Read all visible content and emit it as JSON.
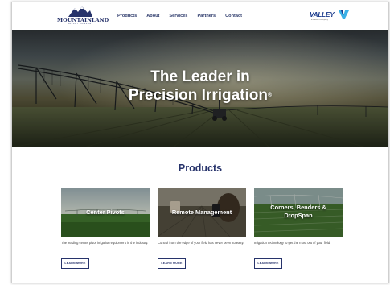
{
  "header": {
    "logo": {
      "name": "MOUNTAINLAND",
      "tagline": "SUPPLY COMPANY"
    },
    "nav": [
      "Products",
      "About",
      "Services",
      "Partners",
      "Contact"
    ],
    "partner_logo": {
      "name": "VALLEY",
      "tagline": "a Valmont company"
    }
  },
  "hero": {
    "line1": "The Leader in",
    "line2": "Precision Irrigation",
    "mark": "®"
  },
  "products": {
    "title": "Products",
    "cards": [
      {
        "title": "Center Pivots",
        "description": "The leading center pivot irrigation equipment in the industry.",
        "button": "LEARN MORE"
      },
      {
        "title": "Remote Management",
        "description": "Control from the edge of your field has never been so easy.",
        "button": "LEARN MORE"
      },
      {
        "title_line1": "Corners, Benders &",
        "title_line2": "DropSpan",
        "description": "Irrigation technology to get the most out of your field.",
        "button": "LEARN MORE"
      }
    ]
  },
  "colors": {
    "brand_navy": "#27336b",
    "valley_blue": "#1a3a8c"
  }
}
